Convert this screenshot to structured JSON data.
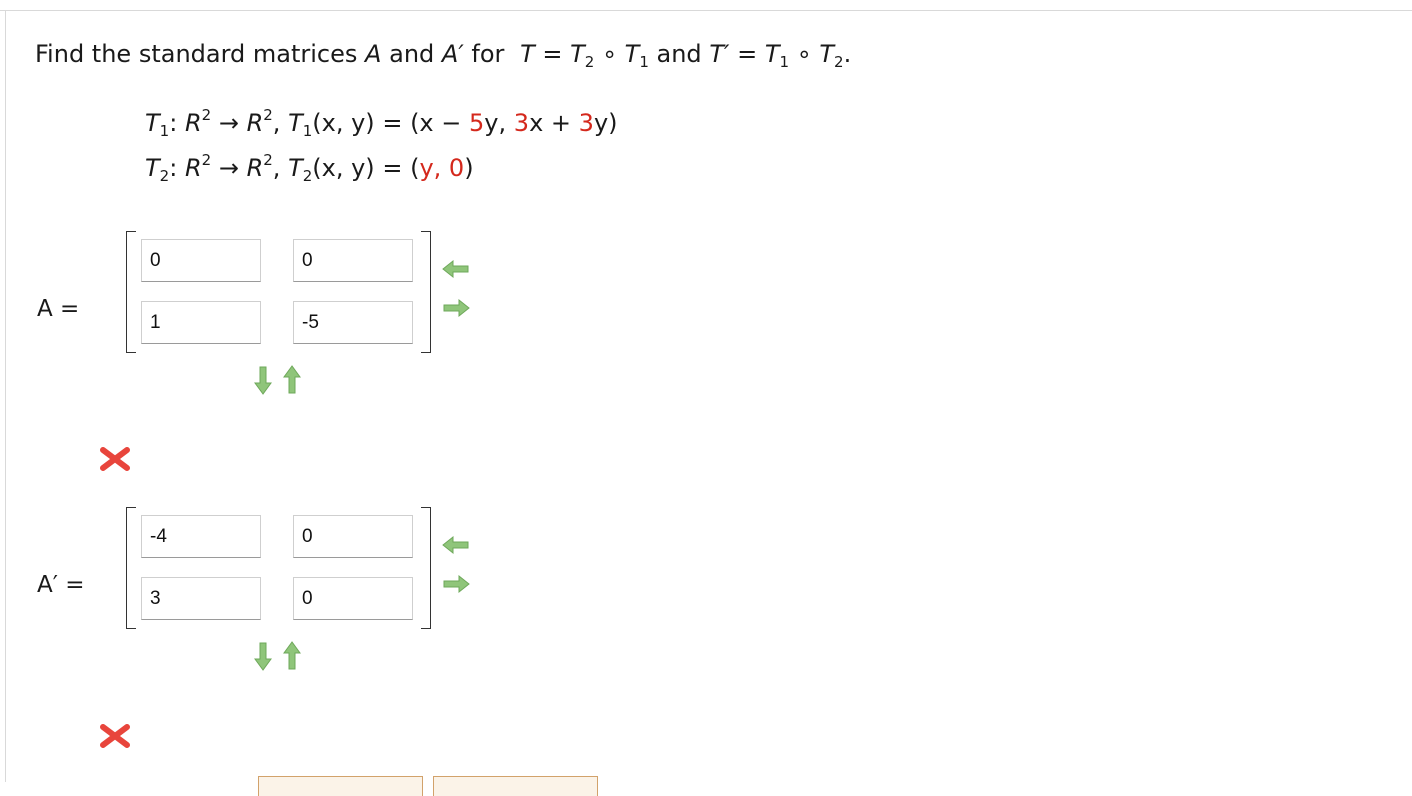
{
  "question": {
    "prefix": "Find the standard matrices",
    "A": "A",
    "and1": "and",
    "A_prime": "A′",
    "for": "for",
    "T": "T",
    "eq": "=",
    "T2": "T",
    "T2_sub": "2",
    "comp": "∘",
    "T1": "T",
    "T1_sub": "1",
    "and2": "and",
    "T_prime": "T′",
    "eq2": "=",
    "T1b": "T",
    "T1b_sub": "1",
    "comp2": "∘",
    "T2b": "T",
    "T2b_sub": "2",
    "period": "."
  },
  "transformations": {
    "t1": {
      "name": "T",
      "sub": "1",
      "domain": "R",
      "domain_exp": "2",
      "arrow": "→",
      "codomain": "R",
      "codomain_exp": "2",
      "func_name": "T",
      "func_sub": "1",
      "args": "(x, y)",
      "equals": "=",
      "open": "(x −",
      "c1": "5",
      "v1": "y,",
      "c2": "3",
      "v2": "x +",
      "c3": "3",
      "close": "y)"
    },
    "t2": {
      "name": "T",
      "sub": "2",
      "domain": "R",
      "domain_exp": "2",
      "arrow": "→",
      "codomain": "R",
      "codomain_exp": "2",
      "func_name": "T",
      "func_sub": "2",
      "args": "(x, y)",
      "equals": "=",
      "open": "(",
      "r1": "y,",
      "r2": "0",
      "close": ")"
    }
  },
  "matrix_A": {
    "label": "A =",
    "values": [
      "0",
      "0",
      "1",
      "-5"
    ],
    "result_icon": "wrong-x-icon"
  },
  "matrix_A_prime": {
    "label": "A′ =",
    "values": [
      "-4",
      "0",
      "3",
      "0"
    ],
    "result_icon": "wrong-x-icon"
  },
  "colors": {
    "highlight_red": "#d4281c",
    "arrow_green": "#8fc57a",
    "wrong_red": "#e8453c"
  }
}
